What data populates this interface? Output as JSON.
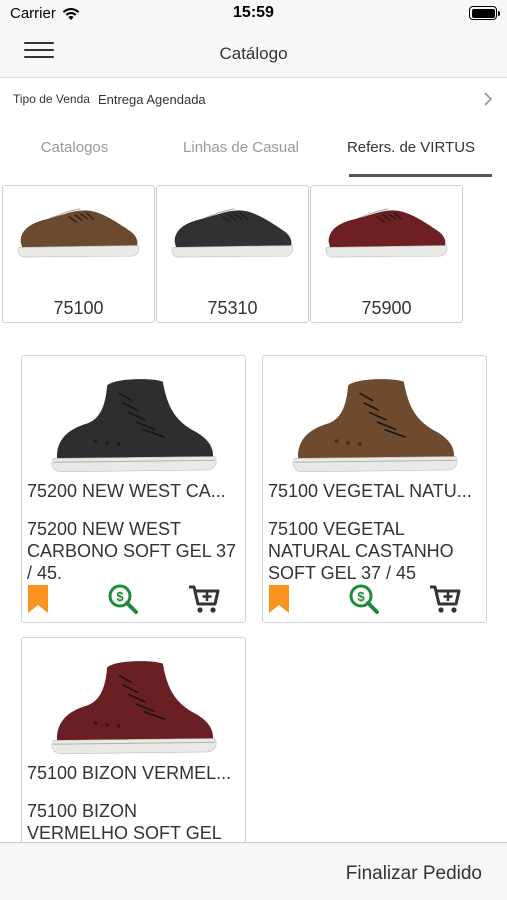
{
  "status_bar": {
    "carrier": "Carrier",
    "time": "15:59",
    "wifi_icon": "wifi-icon",
    "battery_icon": "battery-icon"
  },
  "nav": {
    "title": "Catálogo",
    "menu_icon": "hamburger-menu-icon"
  },
  "sale_type": {
    "label": "Tipo de Venda",
    "value": "Entrega Agendada",
    "chevron_icon": "chevron-right-icon"
  },
  "tabs": [
    {
      "label": "Catalogos",
      "active": false
    },
    {
      "label": "Linhas de Casual",
      "active": false
    },
    {
      "label": "Refers. de VIRTUS",
      "active": true
    }
  ],
  "references": [
    {
      "code": "75100",
      "color": "#6b4a30"
    },
    {
      "code": "75310",
      "color": "#2f3133"
    },
    {
      "code": "75900",
      "color": "#6e1f22"
    }
  ],
  "products": [
    {
      "title": "75200 NEW WEST CA...",
      "description": "75200 NEW WEST CARBONO SOFT GEL 37  / 45.",
      "color": "#2c2e30"
    },
    {
      "title": "75100 VEGETAL NATU...",
      "description": "75100 VEGETAL NATURAL CASTANHO SOFT GEL 37  / 45",
      "color": "#6e4a2e"
    },
    {
      "title": "75100 BIZON VERMEL...",
      "description": "75100 BIZON VERMELHO SOFT GEL",
      "color": "#6a1f24"
    }
  ],
  "card_icons": {
    "bookmark": "bookmark-icon",
    "price": "price-search-icon",
    "cart": "add-to-cart-icon"
  },
  "colors": {
    "bookmark": "#f7931e",
    "price": "#1e8a3c",
    "cart": "#333333",
    "tab_active": "#333333",
    "tab_inactive": "#9a9a9a"
  },
  "bottom_bar": {
    "finalize_label": "Finalizar Pedido"
  }
}
